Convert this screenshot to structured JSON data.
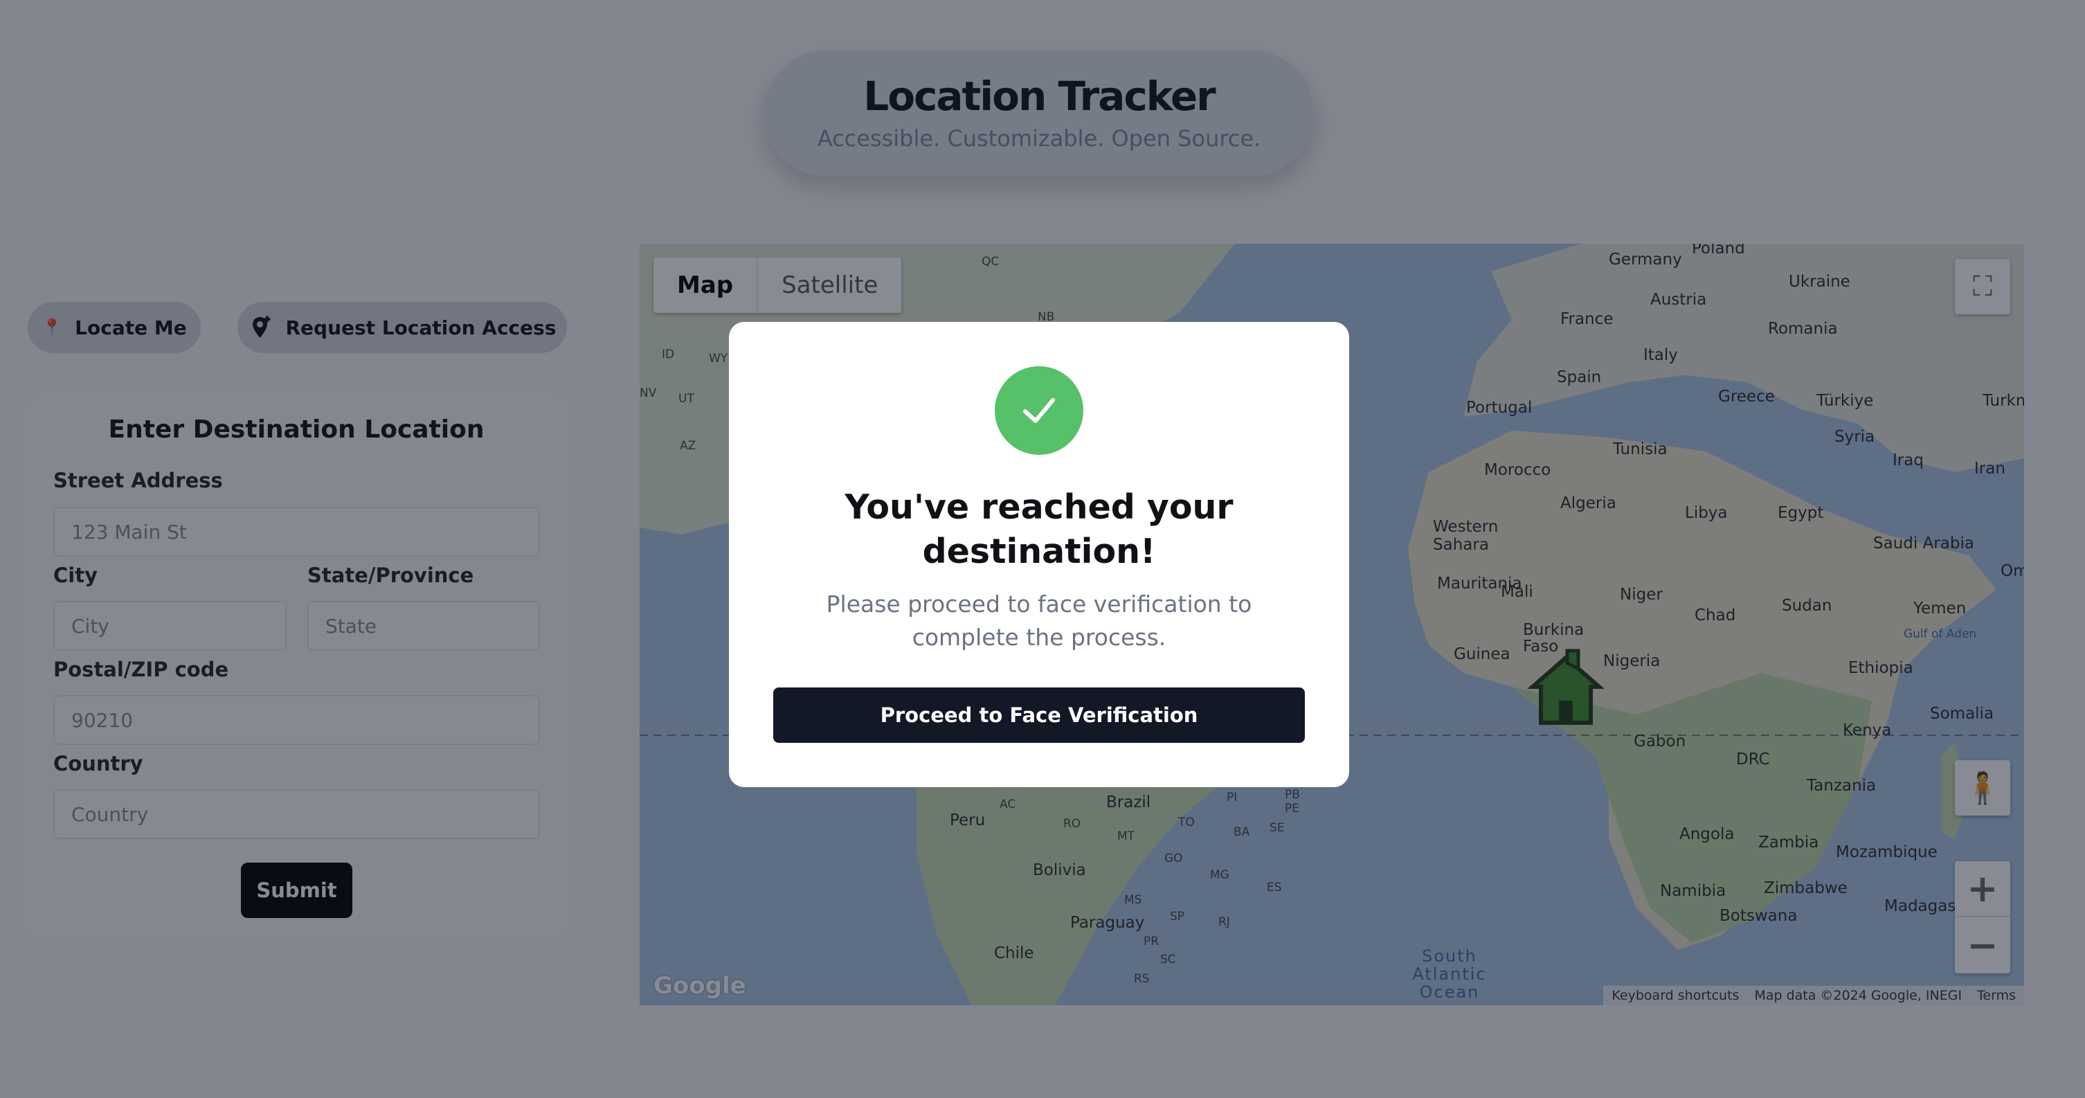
{
  "header": {
    "title": "Location Tracker",
    "subtitle": "Accessible. Customizable. Open Source."
  },
  "actions": {
    "locate_me": "Locate Me",
    "request_access": "Request Location Access"
  },
  "form": {
    "title": "Enter Destination Location",
    "street_label": "Street Address",
    "street_placeholder": "123 Main St",
    "city_label": "City",
    "city_placeholder": "City",
    "state_label": "State/Province",
    "state_placeholder": "State",
    "postal_label": "Postal/ZIP code",
    "postal_placeholder": "90210",
    "country_label": "Country",
    "country_placeholder": "Country",
    "submit_label": "Submit"
  },
  "map": {
    "type_map": "Map",
    "type_satellite": "Satellite",
    "logo": "Google",
    "attribution": {
      "shortcuts": "Keyboard shortcuts",
      "data": "Map data ©2024 Google, INEGI",
      "terms": "Terms"
    },
    "labels": {
      "germany": "Germany",
      "poland": "Poland",
      "ukraine": "Ukraine",
      "austria": "Austria",
      "france": "France",
      "romania": "Romania",
      "italy": "Italy",
      "spain": "Spain",
      "portugal": "Portugal",
      "greece": "Greece",
      "turkiye": "Türkiye",
      "turkm": "Turkm",
      "tunisia": "Tunisia",
      "syria": "Syria",
      "iraq": "Iraq",
      "iran": "Iran",
      "morocco": "Morocco",
      "algeria": "Algeria",
      "libya": "Libya",
      "egypt": "Egypt",
      "western_sahara": "Western Sahara",
      "saudi_arabia": "Saudi Arabia",
      "oman": "Omar",
      "mauritania": "Mauritania",
      "mali": "Mali",
      "niger": "Niger",
      "chad": "Chad",
      "sudan": "Sudan",
      "yemen": "Yemen",
      "gulf_aden": "Gulf of Aden",
      "burkina_faso": "Burkina Faso",
      "guinea": "Guinea",
      "nigeria": "Nigeria",
      "ethiopia": "Ethiopia",
      "somalia": "Somalia",
      "gabon": "Gabon",
      "kenya": "Kenya",
      "drc": "DRC",
      "tanzania": "Tanzania",
      "angola": "Angola",
      "zambia": "Zambia",
      "mozambique": "Mozambique",
      "namibia": "Namibia",
      "zimbabwe": "Zimbabwe",
      "botswana": "Botswana",
      "madagascar": "Madagasc",
      "brazil": "Brazil",
      "peru": "Peru",
      "bolivia": "Bolivia",
      "paraguay": "Paraguay",
      "chile": "Chile",
      "south_atlantic": "South Atlantic Ocean",
      "qc": "QC",
      "nb": "NB",
      "id": "ID",
      "wy": "WY",
      "nv": "NV",
      "ut": "UT",
      "az": "AZ",
      "ac": "AC",
      "ro": "RO",
      "mt": "MT",
      "to": "TO",
      "ba": "BA",
      "se": "SE",
      "pe": "PE",
      "pb": "PB",
      "pi": "PI",
      "go": "GO",
      "mg": "MG",
      "es": "ES",
      "ms": "MS",
      "sp": "SP",
      "rj": "RJ",
      "pr": "PR",
      "sc": "SC",
      "rs": "RS"
    }
  },
  "modal": {
    "title": "You've reached your destination!",
    "message": "Please proceed to face verification to complete the process.",
    "button": "Proceed to Face Verification"
  }
}
